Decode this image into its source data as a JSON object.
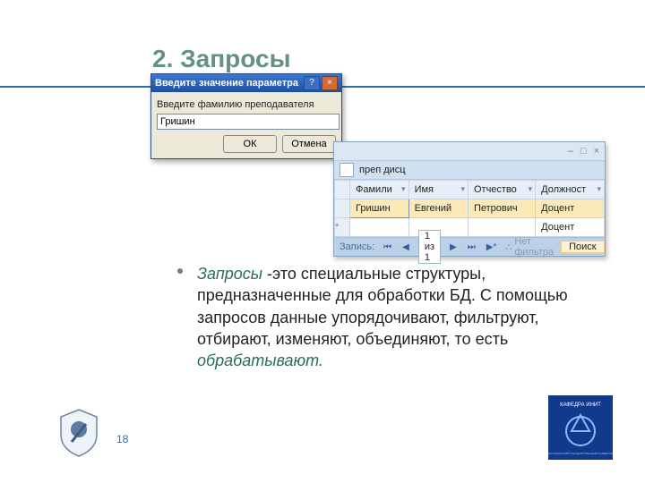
{
  "slide": {
    "title": "2. Запросы",
    "page_number": "18",
    "bullet": {
      "lead_em": "Запросы",
      "body": " -это специальные структуры, предназначенные для обработки БД. С помощью запросов данные упорядочивают, фильтруют, отбирают, изменяют, объединяют, то есть ",
      "tail_em": "обрабатывают."
    }
  },
  "dialog": {
    "title": "Введите значение параметра",
    "prompt": "Введите фамилию преподавателя",
    "value": "Гришин",
    "ok": "ОК",
    "cancel": "Отмена"
  },
  "grid_window": {
    "tab_title": "преп дисц",
    "min_glyph": "–",
    "state_glyph": "□",
    "close_glyph": "×",
    "columns": [
      "Фамили",
      "Имя",
      "Отчество",
      "Должност"
    ],
    "dd_glyph": "▾",
    "rows": [
      {
        "surname": "Гришин",
        "name": "Евгений",
        "patronymic": "Петрович",
        "position": "Доцент",
        "editing": true
      },
      {
        "surname": "",
        "name": "",
        "patronymic": "",
        "position": "Доцент",
        "new": true
      }
    ],
    "new_marker": "*",
    "nav": {
      "label": "Запись:",
      "first": "⏮",
      "prev": "◀",
      "pos": "1 из 1",
      "next": "▶",
      "last": "⏭",
      "new": "▶*",
      "filter_icon": "⛬",
      "filter_text": "Нет фильтра",
      "search": "Поиск"
    }
  },
  "logos": {
    "left_alt": "университетская эмблема",
    "right_top": "КАФЕДРА ИНИТ",
    "right_bottom": "ЮЖНО-УРАЛЬСКИЙ ГОСУДАРСТВЕННЫЙ УНИВЕРСИТЕТ"
  }
}
